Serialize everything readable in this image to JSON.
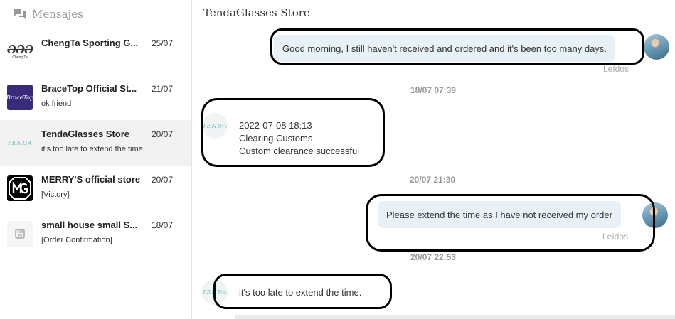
{
  "sidebar": {
    "title": "Mensajes",
    "icon": "chat-bubbles-icon",
    "conversations": [
      {
        "name": "ChengTa Sporting G...",
        "date": "25/07",
        "preview": "",
        "logo_text": "ƏƏƏ",
        "logo_sub": "Cheng Ta",
        "logo": "chengta-logo"
      },
      {
        "name": "BraceTop Official St...",
        "date": "21/07",
        "preview": "ok friend",
        "logo_text": "BraceTop",
        "logo": "bracetop-logo"
      },
      {
        "name": "TendaGlasses Store",
        "date": "20/07",
        "preview": "it's too late to extend the time.",
        "logo_text": "TENDA",
        "logo": "tenda-logo",
        "active": true
      },
      {
        "name": "MERRY'S official store",
        "date": "20/07",
        "preview": "[Victory]",
        "logo": "mg-logo"
      },
      {
        "name": "small house small S...",
        "date": "18/07",
        "preview": "[Order Confirmation]",
        "logo": "store-logo"
      }
    ]
  },
  "chat": {
    "title": "TendaGlasses Store",
    "store_avatar_text": "TENDA",
    "messages": [
      {
        "dir": "out",
        "text": "Good morning, I still haven't received and ordered and it's been too many days.",
        "status": "Leídos"
      },
      {
        "timestamp": "18/07 07:39"
      },
      {
        "dir": "in",
        "lines": [
          "2022-07-08 18:13",
          "Clearing Customs",
          "Custom clearance successful"
        ]
      },
      {
        "timestamp": "20/07 21:30"
      },
      {
        "dir": "out",
        "text": "Please extend the time as I have not received my order",
        "status": "Leídos"
      },
      {
        "timestamp": "20/07 22:53"
      },
      {
        "dir": "in",
        "text": "it's too late to extend the time."
      }
    ]
  },
  "colors": {
    "outgoing_bubble": "#e9f1f8",
    "active_conversation": "#f2f2f2",
    "annotation": "#000000"
  }
}
